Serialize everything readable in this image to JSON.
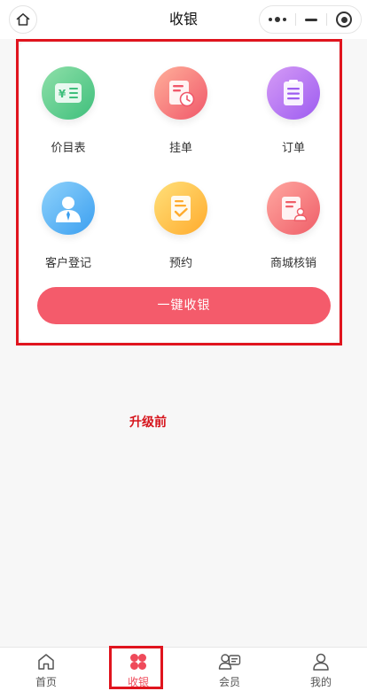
{
  "navbar": {
    "title": "收银",
    "home_icon": "home-icon",
    "more_icon": "more-dots-icon",
    "minimize_icon": "minimize-icon",
    "close_icon": "target-close-icon"
  },
  "features": [
    {
      "label": "价目表",
      "icon": "price-list-icon",
      "color": "#3fbf7c"
    },
    {
      "label": "挂单",
      "icon": "pending-order-icon",
      "color": "#f0576a"
    },
    {
      "label": "订单",
      "icon": "order-icon",
      "color": "#9d5cf0"
    },
    {
      "label": "客户登记",
      "icon": "customer-register-icon",
      "color": "#3b9ff0"
    },
    {
      "label": "预约",
      "icon": "appointment-icon",
      "color": "#ffab2d"
    },
    {
      "label": "商城核销",
      "icon": "mall-verify-icon",
      "color": "#ef5e68"
    }
  ],
  "pay_button": {
    "label": "一键收银",
    "color": "#f45b6b"
  },
  "annotation": {
    "text": "升级前",
    "color": "#d6141c"
  },
  "tabbar": {
    "active_color": "#ef4a5a",
    "items": [
      {
        "label": "首页",
        "icon": "home-icon"
      },
      {
        "label": "收银",
        "icon": "cashier-grid-icon",
        "active": true
      },
      {
        "label": "会员",
        "icon": "member-card-icon"
      },
      {
        "label": "我的",
        "icon": "profile-icon"
      }
    ]
  }
}
